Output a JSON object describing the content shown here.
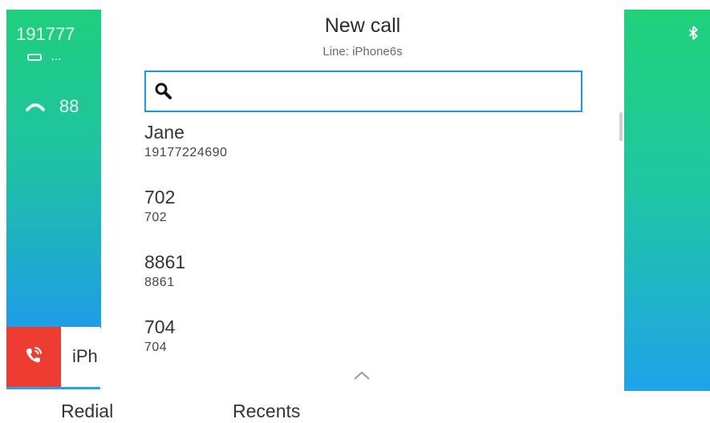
{
  "left_panel": {
    "line_number": "191777",
    "line_status": "...",
    "call_number": "88"
  },
  "bottom_line_tab": {
    "label": "iPh"
  },
  "dialog": {
    "title": "New call",
    "subtitle": "Line: iPhone6s"
  },
  "search": {
    "value": "",
    "placeholder": ""
  },
  "results": [
    {
      "name": "Jane",
      "number": "19177224690"
    },
    {
      "name": "702",
      "number": "702"
    },
    {
      "name": "8861",
      "number": "8861"
    },
    {
      "name": "704",
      "number": "704"
    }
  ],
  "softkeys": {
    "redial": "Redial",
    "recents": "Recents"
  },
  "icons": {
    "search": "search-icon",
    "bluetooth": "bluetooth-icon",
    "handset": "handset-icon",
    "phone_ring": "phone-ring-icon",
    "chevron_up": "chevron-up-icon"
  },
  "colors": {
    "accent_blue": "#1a98e0",
    "call_red": "#ef3c32",
    "gradient_green": "#1fcf7c",
    "gradient_blue": "#1e9de6"
  }
}
